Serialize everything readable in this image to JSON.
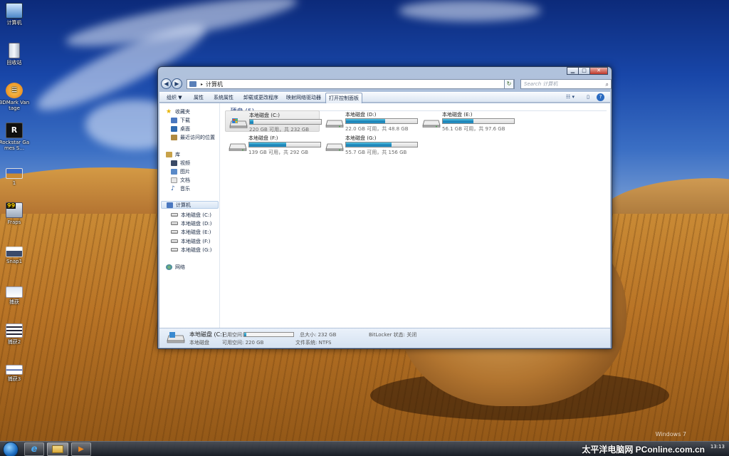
{
  "desktop": {
    "icons": [
      {
        "label": "计算机",
        "icon": "computer-icon"
      },
      {
        "label": "回收站",
        "icon": "recycle-bin-icon"
      },
      {
        "label": "3DMark Vantage",
        "icon": "3dmark-icon"
      },
      {
        "label": "Rockstar Games S...",
        "icon": "rockstar-icon"
      },
      {
        "label": "1",
        "icon": "image-file-icon"
      },
      {
        "label": "Fraps",
        "icon": "fraps-icon"
      },
      {
        "label": "Snap1",
        "icon": "image-file-icon"
      },
      {
        "label": "捕获",
        "icon": "image-file-icon"
      },
      {
        "label": "捕获2",
        "icon": "image-file-icon"
      },
      {
        "label": "捕获3",
        "icon": "image-file-icon"
      }
    ],
    "fraps_badge": "99"
  },
  "window": {
    "address": {
      "path": "计算机",
      "separator": "▸"
    },
    "search_placeholder": "Search 计算机",
    "toolbar": {
      "organize": "组织 ▼",
      "properties": "属性",
      "system_properties": "系统属性",
      "uninstall": "卸载或更改程序",
      "map_drive": "映射网络驱动器",
      "control_panel": "打开控制面板"
    },
    "sidebar": {
      "favorites": "收藏夹",
      "downloads": "下载",
      "desktop": "桌面",
      "recent": "最近访问的位置",
      "libraries": "库",
      "videos": "视频",
      "pictures": "图片",
      "documents": "文档",
      "music": "音乐",
      "computer": "计算机",
      "drives": [
        "本地磁盘 (C:)",
        "本地磁盘 (D:)",
        "本地磁盘 (E:)",
        "本地磁盘 (F:)",
        "本地磁盘 (G:)"
      ],
      "network": "网络"
    },
    "section_title": "硬盘 (5)",
    "drives": [
      {
        "name": "本地磁盘 (C:)",
        "space": "220 GB 可用，共 232 GB",
        "used_fraction": 0.05
      },
      {
        "name": "本地磁盘 (D:)",
        "space": "22.0 GB 可用，共 48.8 GB",
        "used_fraction": 0.55
      },
      {
        "name": "本地磁盘 (E:)",
        "space": "56.1 GB 可用，共 97.6 GB",
        "used_fraction": 0.43
      },
      {
        "name": "本地磁盘 (F:)",
        "space": "139 GB 可用，共 292 GB",
        "used_fraction": 0.52
      },
      {
        "name": "本地磁盘 (G:)",
        "space": "55.7 GB 可用，共 156 GB",
        "used_fraction": 0.64
      }
    ],
    "details": {
      "name": "本地磁盘 (C:)",
      "type": "本地磁盘",
      "space_used_label": "已用空间:",
      "space_free_label": "可用空间: 220 GB",
      "total_size": "总大小: 232 GB",
      "filesystem": "文件系统: NTFS",
      "bitlocker": "BitLocker 状态: 关闭",
      "used_fraction": 0.05
    }
  },
  "taskbar": {
    "brand": "太平洋电脑网 PConline.com.cn",
    "clock_time": "13:13",
    "watermark": "Windows 7"
  },
  "colors": {
    "accent": "#1b7fb4",
    "sky": "#1846a8",
    "field": "#b97426"
  }
}
